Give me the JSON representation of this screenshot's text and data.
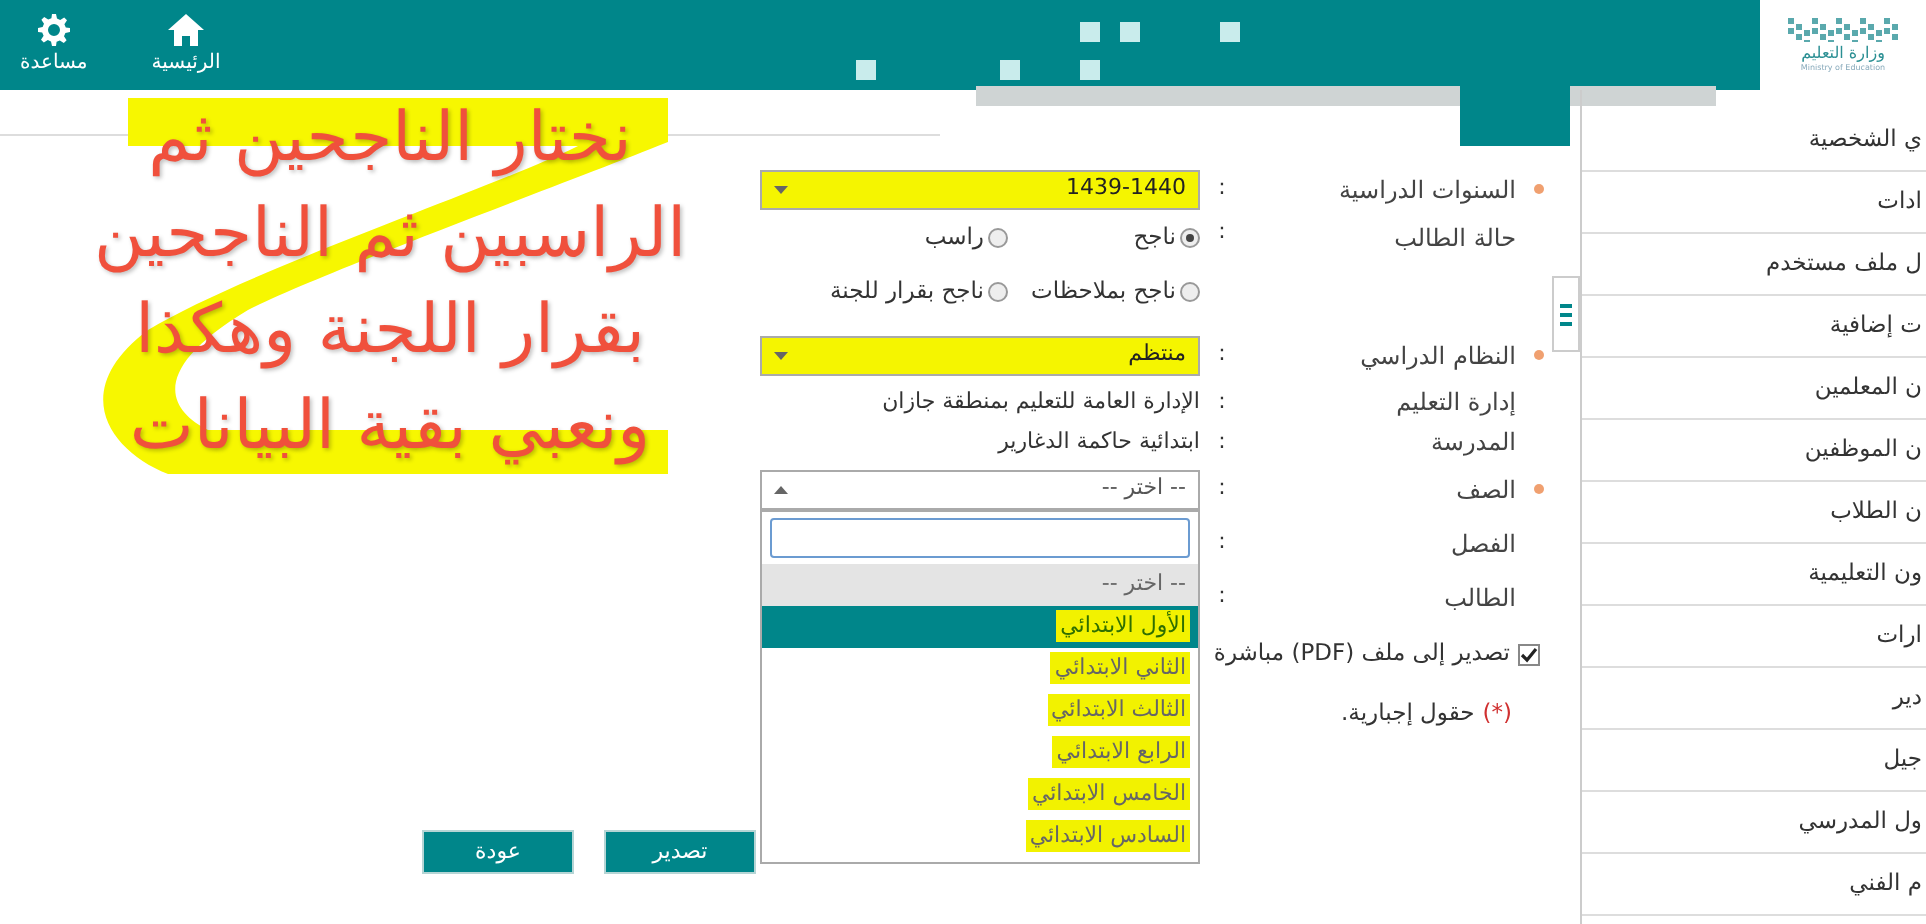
{
  "header": {
    "nav": [
      {
        "kind": "home",
        "label": "الرئيسية"
      },
      {
        "kind": "help",
        "label": "مساعدة"
      }
    ],
    "logo": {
      "title": "وزارة التعليم",
      "subtitle": "Ministry of Education"
    }
  },
  "sidebar": {
    "items": [
      "ي الشخصية",
      "ادات",
      "ل ملف مستخدم",
      "ت إضافية",
      "ن المعلمين",
      "ن الموظفين",
      "ن الطلاب",
      "ون التعليمية",
      "ارات",
      "دير",
      "جيل",
      "ول المدرسي",
      "م الفني"
    ]
  },
  "form": {
    "fields": [
      {
        "kind": "select",
        "label": "السنوات الدراسية",
        "separator": ":",
        "required": true,
        "value": "1439-1440",
        "highlighted": true,
        "open": false
      },
      {
        "kind": "radios",
        "label": "حالة الطالب",
        "separator": ":",
        "required": false,
        "options": [
          {
            "label": "ناجح",
            "selected": true
          },
          {
            "label": "راسب",
            "selected": false
          },
          {
            "label": "ناجح بملاحظات",
            "selected": false
          },
          {
            "label": "ناجح بقرار للجنة",
            "selected": false
          }
        ]
      },
      {
        "kind": "select",
        "label": "النظام الدراسي",
        "separator": ":",
        "required": true,
        "value": "منتظم",
        "highlighted": true,
        "open": false
      },
      {
        "kind": "text",
        "label": "إدارة التعليم",
        "separator": ":",
        "required": false,
        "value": "الإدارة العامة للتعليم بمنطقة جازان"
      },
      {
        "kind": "text",
        "label": "المدرسة",
        "separator": ":",
        "required": false,
        "value": "ابتدائية حاكمة الدغارير"
      },
      {
        "kind": "select",
        "label": "الصف",
        "separator": ":",
        "required": true,
        "value": "-- اختر --",
        "highlighted": false,
        "open": true
      },
      {
        "kind": "empty",
        "label": "الفصل",
        "separator": ":",
        "required": false
      },
      {
        "kind": "empty",
        "label": "الطالب",
        "separator": ":",
        "required": false
      }
    ],
    "export_checkbox": {
      "label": "تصدير إلى ملف (PDF) مباشرة",
      "checked": true
    },
    "note": {
      "marker": "(*)",
      "text": "حقول إجبارية."
    },
    "buttons": [
      "تصدير",
      "عودة"
    ]
  },
  "dropdown": {
    "options": [
      {
        "label": "-- اختر --",
        "selected": false,
        "highlighted": false
      },
      {
        "label": "الأول الابتدائي",
        "selected": true,
        "highlighted": true
      },
      {
        "label": "الثاني الابتدائي",
        "selected": false,
        "highlighted": true
      },
      {
        "label": "الثالث الابتدائي",
        "selected": false,
        "highlighted": true
      },
      {
        "label": "الرابع الابتدائي",
        "selected": false,
        "highlighted": true
      },
      {
        "label": "الخامس الابتدائي",
        "selected": false,
        "highlighted": true
      },
      {
        "label": "السادس الابتدائي",
        "selected": false,
        "highlighted": true
      }
    ]
  },
  "annotation": {
    "lines": [
      "نختار الناجحين ثم",
      "الراسبين ثم الناجحين",
      "بقرار اللجنة وهكذا",
      "ونعبي بقية البيانات"
    ]
  }
}
